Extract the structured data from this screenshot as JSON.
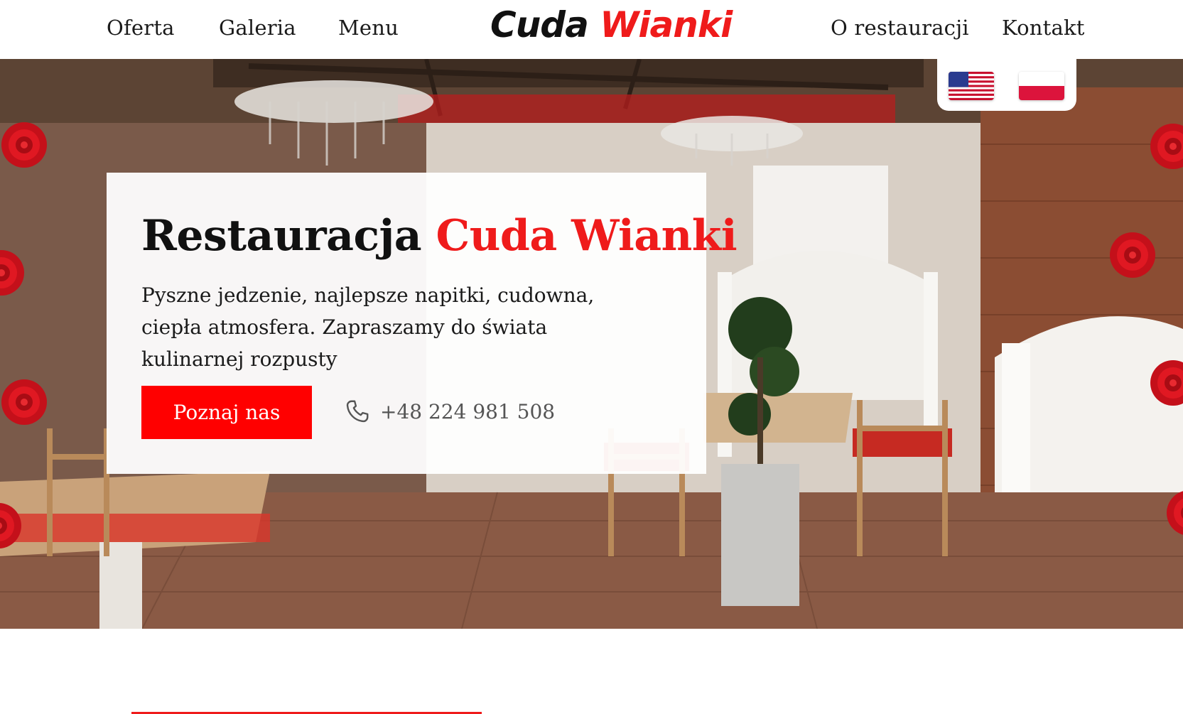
{
  "nav": {
    "left": [
      "Oferta",
      "Galeria",
      "Menu"
    ],
    "right": [
      "O restauracji",
      "Kontakt"
    ]
  },
  "logo": {
    "word1": "Cuda",
    "word2": "Wianki"
  },
  "lang": {
    "options": [
      "us-flag-icon",
      "pl-flag-icon"
    ]
  },
  "hero": {
    "title_plain": "Restauracja",
    "title_accent": "Cuda Wianki",
    "lead": "Pyszne jedzenie, najlepsze napitki, cudowna, ciepła atmosfera. Zapraszamy do świata kulinarnej rozpusty",
    "cta_label": "Poznaj nas",
    "phone": "+48 224 981 508"
  },
  "colors": {
    "accent": "#ef1b1b",
    "button": "#ff0000",
    "text": "#111111"
  },
  "icons": [
    "phone-icon",
    "rose-icon"
  ]
}
